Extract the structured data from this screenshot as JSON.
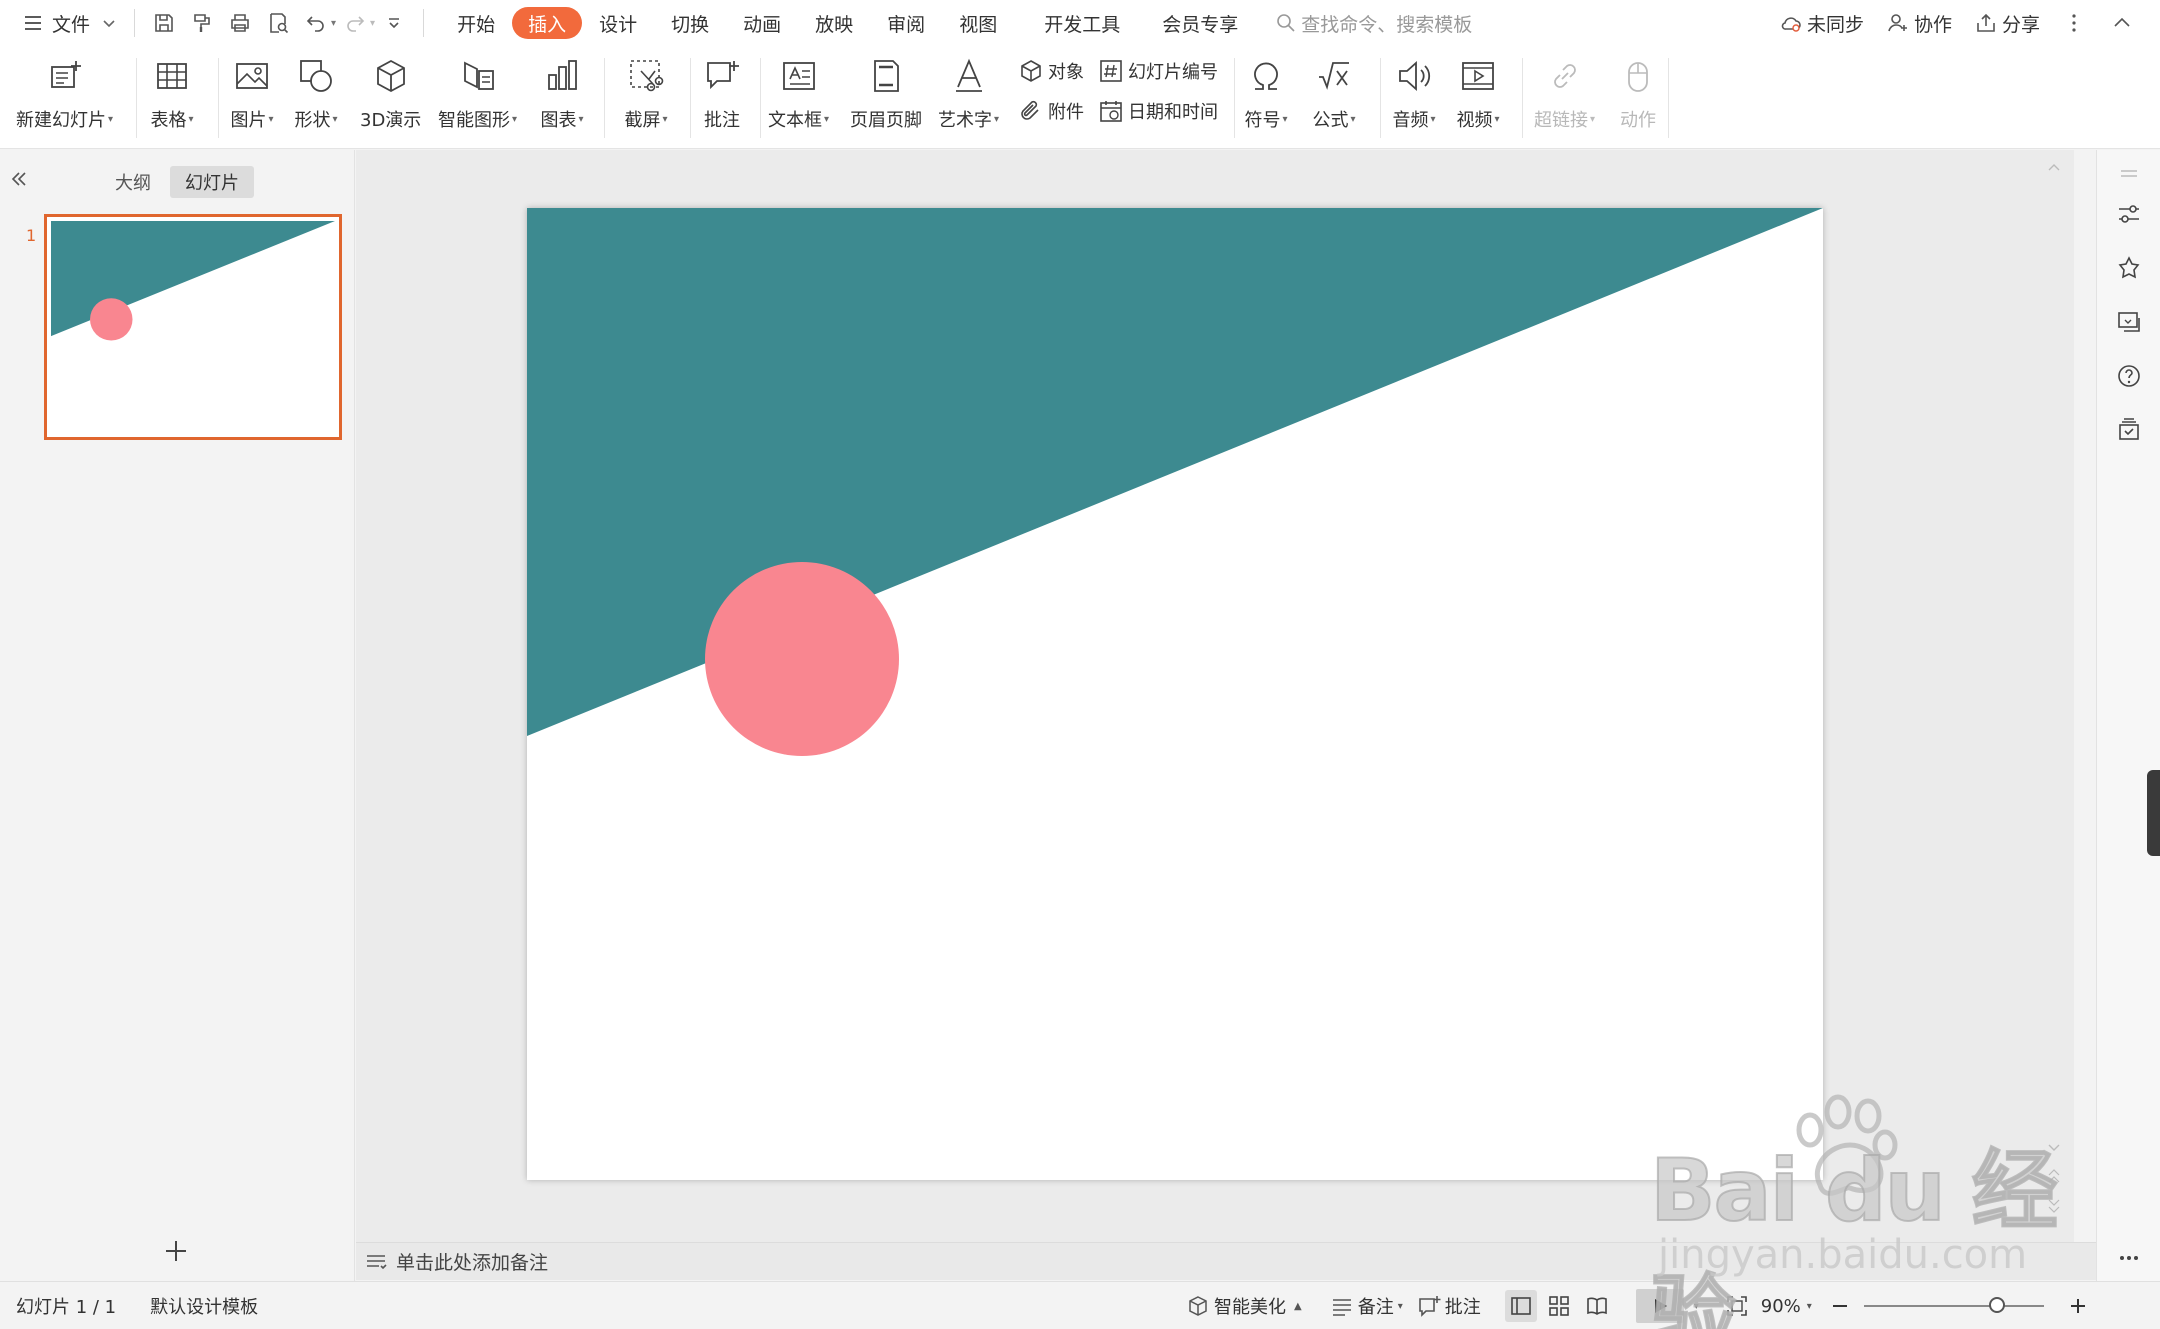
{
  "menubar": {
    "file_label": "文件",
    "tabs": [
      {
        "label": "开始"
      },
      {
        "label": "插入",
        "active": true
      },
      {
        "label": "设计"
      },
      {
        "label": "切换"
      },
      {
        "label": "动画"
      },
      {
        "label": "放映"
      },
      {
        "label": "审阅"
      },
      {
        "label": "视图"
      },
      {
        "label": "开发工具"
      },
      {
        "label": "会员专享"
      }
    ],
    "search_placeholder": "查找命令、搜索模板",
    "sync_label": "未同步",
    "collab_label": "协作",
    "share_label": "分享"
  },
  "ribbon": {
    "new_slide": "新建幻灯片",
    "table": "表格",
    "picture": "图片",
    "shape": "形状",
    "demo3d": "3D演示",
    "smartart": "智能图形",
    "chart": "图表",
    "screenshot": "截屏",
    "comment": "批注",
    "textbox": "文本框",
    "header_footer": "页眉页脚",
    "wordart": "艺术字",
    "object": "对象",
    "attachment": "附件",
    "slide_number": "幻灯片编号",
    "datetime": "日期和时间",
    "symbol": "符号",
    "formula": "公式",
    "audio": "音频",
    "video": "视频",
    "hyperlink": "超链接",
    "action": "动作"
  },
  "leftpanel": {
    "outline_tab": "大纲",
    "slides_tab": "幻灯片",
    "slide_number": "1"
  },
  "slide": {
    "teal_color": "#3d8a90",
    "circle_color": "#f98690"
  },
  "notes_placeholder": "单击此处添加备注",
  "statusbar": {
    "slide_indicator": "幻灯片 1 / 1",
    "template": "默认设计模板",
    "smart_beautify": "智能美化",
    "notes": "备注",
    "comments": "批注",
    "zoom": "90%",
    "zoom_fraction": 0.4
  },
  "watermark": {
    "logo": "Bai du 经验",
    "url": "jingyan.baidu.com"
  },
  "colors": {
    "accent": "#f26a3c",
    "selection_border": "#e0662e"
  }
}
